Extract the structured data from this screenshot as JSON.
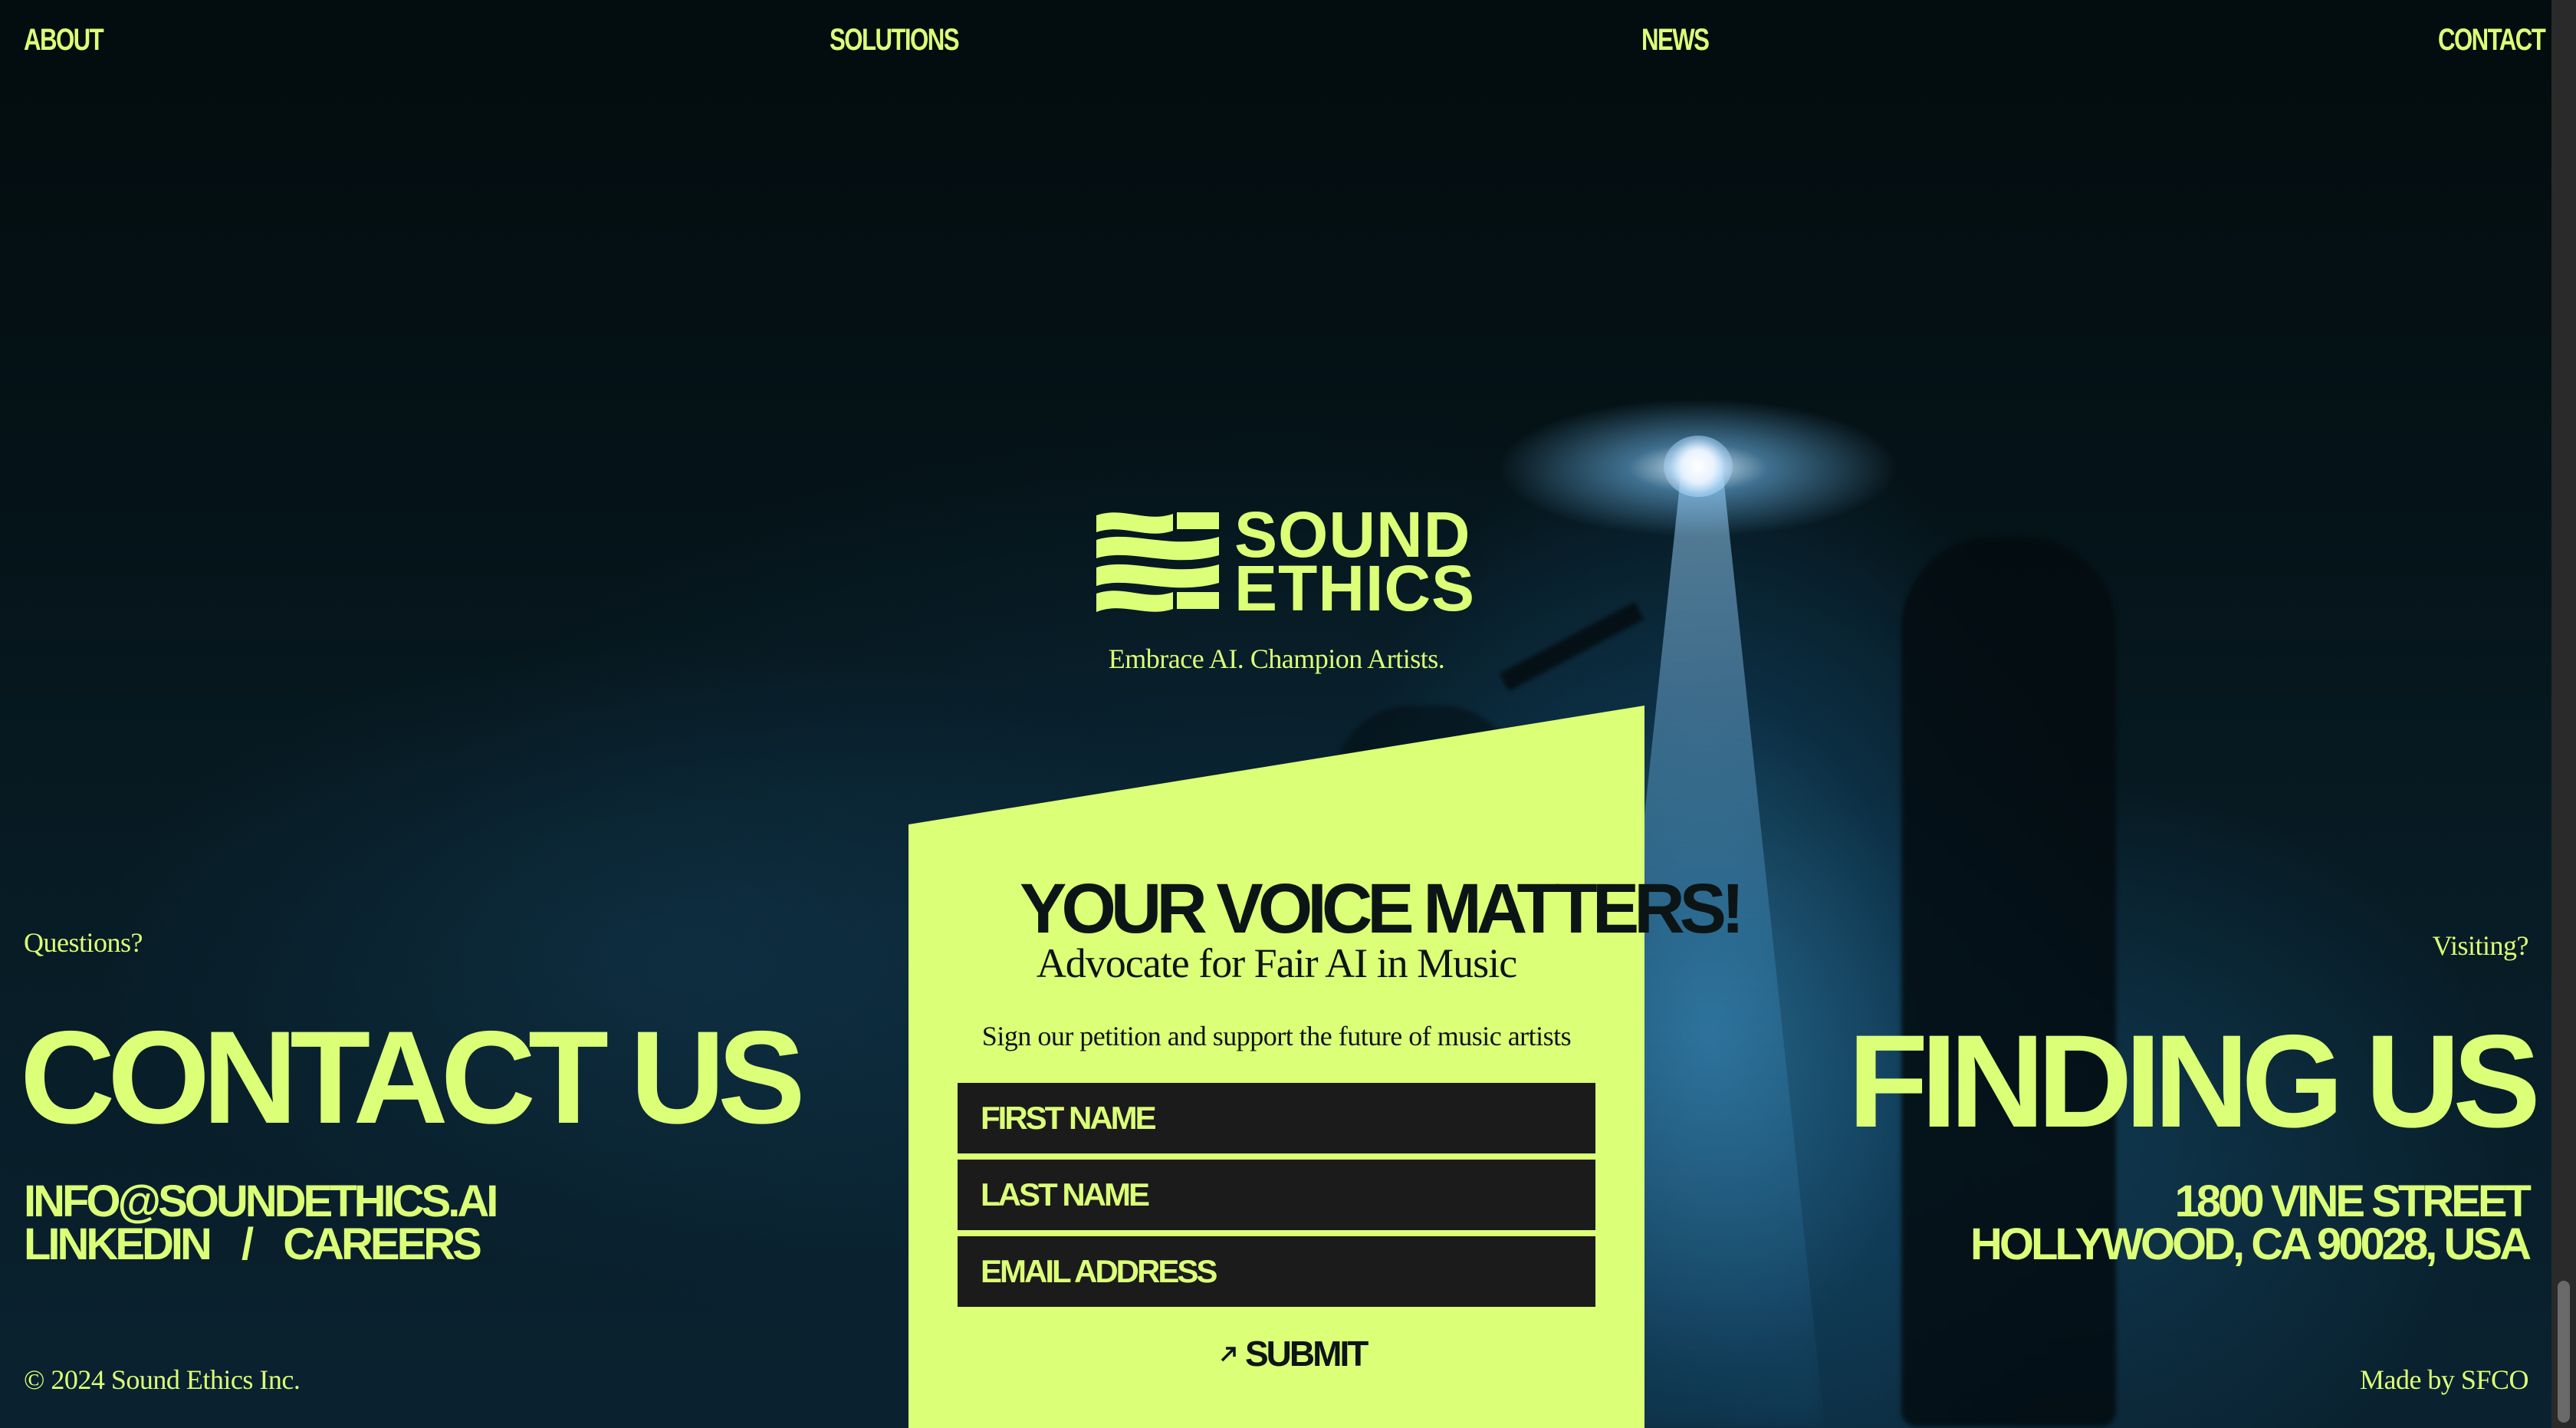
{
  "nav": {
    "about": "ABOUT",
    "solutions": "SOLUTIONS",
    "news": "NEWS",
    "contact": "CONTACT"
  },
  "brand": {
    "line1": "SOUND",
    "line2": "ETHICS",
    "tagline": "Embrace AI. Champion Artists.",
    "accent_color": "#dcff78",
    "logo_icon": "flag-waves-icon"
  },
  "contact": {
    "eyebrow": "Questions?",
    "title": "CONTACT US",
    "email": "INFO@SOUNDETHICS.AI",
    "linkedin": "LINKEDIN",
    "separator": "/",
    "careers": "CAREERS"
  },
  "location": {
    "eyebrow": "Visiting?",
    "title": "FINDING US",
    "address_line1": "1800 VINE STREET",
    "address_line2": "HOLLYWOOD, CA 90028, USA"
  },
  "petition": {
    "headline": "YOUR VOICE MATTERS!",
    "subhead": "Advocate for Fair AI in Music",
    "description": "Sign our petition and support the future of music artists",
    "first_name_placeholder": "FIRST NAME",
    "last_name_placeholder": "LAST NAME",
    "email_placeholder": "EMAIL ADDRESS",
    "submit_label": "SUBMIT",
    "submit_icon": "arrow-up-right-icon"
  },
  "footer": {
    "copyright": "© 2024 Sound Ethics Inc.",
    "credit": "Made by SFCO"
  }
}
